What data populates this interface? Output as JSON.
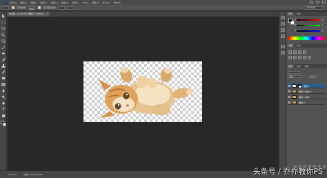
{
  "menubar": {
    "logo": "Ps",
    "items": [
      "文件(F)",
      "编辑(E)",
      "图像(I)",
      "图层(L)",
      "类型(Y)",
      "选择(S)",
      "滤镜(T)",
      "3D(D)",
      "视图(V)",
      "窗口(W)",
      "帮助(H)"
    ]
  },
  "optionsbar": {
    "auto_select": "自动选择:",
    "target": "图层",
    "transform": "显示变换控件",
    "workspace": "基本功能"
  },
  "document": {
    "tab_title": "未标题-1 @ 66.7% (图层 1, RGB/8)",
    "close": "×"
  },
  "status": {
    "zoom": "66.67%",
    "docinfo": "文档:1.91M/4.03M",
    "timeline": "时间轴"
  },
  "panels": {
    "color_tabs": [
      "颜色",
      "色板"
    ],
    "sliders": [
      {
        "label": "R",
        "value": "0",
        "color": "#ff4444"
      },
      {
        "label": "G",
        "value": "0",
        "color": "#44ff44"
      },
      {
        "label": "B",
        "value": "0",
        "color": "#4488ff"
      }
    ],
    "adj_tabs": [
      "调整",
      "样式"
    ],
    "layer_tabs": [
      "图层",
      "通道",
      "路径"
    ],
    "layer_mode": "正常",
    "layer_opacity": "100%",
    "layers": [
      {
        "name": "图层 1",
        "selected": true,
        "mask": true
      },
      {
        "name": "图层 1 拷贝 2",
        "selected": false,
        "mask": false
      },
      {
        "name": "图层 1 拷贝",
        "selected": false,
        "mask": false
      },
      {
        "name": "图层 0",
        "selected": false,
        "mask": false
      }
    ]
  },
  "watermark": "头条号 / 乔乔教你PS",
  "colors": {
    "selection": "#2d5e8a",
    "workspace": "#282828",
    "panel": "#535353"
  }
}
